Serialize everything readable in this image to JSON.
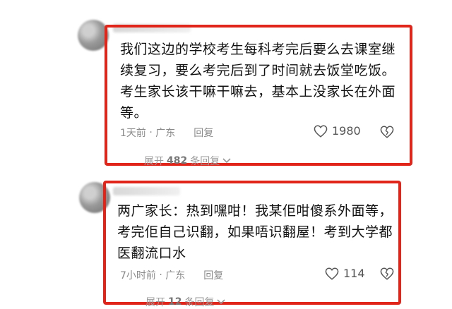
{
  "comments": [
    {
      "text_lines": [
        "我们这边的学校考生每科考完后要么去课室继",
        "续复习，要么考完后到了时间就去饭堂吃饭。",
        "考生家长该干嘛干嘛去，基本上没家长在外面",
        "等。"
      ],
      "time": "1天前",
      "location": "广东",
      "reply_label": "回复",
      "likes": "1980",
      "expand_prefix": "展开",
      "expand_count": "482",
      "expand_suffix": "条回复",
      "icons": [
        "heart-icon",
        "broken-heart-icon",
        "chevron-down-icon"
      ]
    },
    {
      "text_lines": [
        "两广家长：热到嘿咁！我某佢咁傻系外面等，",
        "考完佢自己识翻，如果唔识翻屋！考到大学都",
        "医翻流口水"
      ],
      "time": "7小时前",
      "location": "广东",
      "reply_label": "回复",
      "likes": "114",
      "expand_prefix": "展开",
      "expand_count": "12",
      "expand_suffix": "条回复",
      "icons": [
        "heart-icon",
        "broken-heart-icon",
        "chevron-down-icon"
      ]
    }
  ],
  "colors": {
    "highlight_frame": "#e1251b",
    "meta_text": "#8a8a8a"
  }
}
